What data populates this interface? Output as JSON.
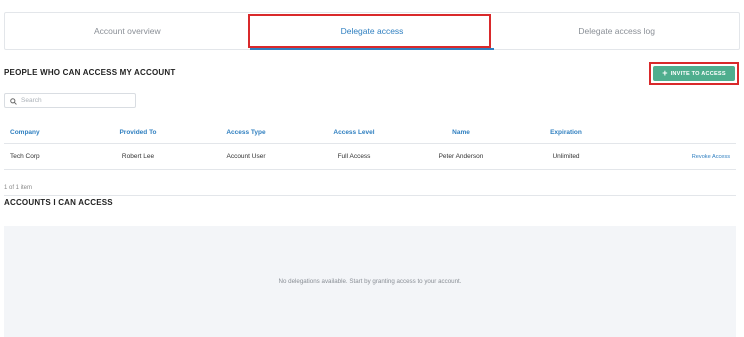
{
  "tabs": [
    {
      "label": "Account overview"
    },
    {
      "label": "Delegate access"
    },
    {
      "label": "Delegate access log"
    }
  ],
  "active_tab": "Delegate access",
  "section1": {
    "title": "PEOPLE WHO CAN ACCESS MY ACCOUNT",
    "invite_button": "INVITE TO ACCESS",
    "search_placeholder": "Search"
  },
  "table": {
    "headers": [
      "Company",
      "Provided To",
      "Access Type",
      "Access Level",
      "Name",
      "Expiration"
    ],
    "rows": [
      {
        "company": "Tech Corp",
        "provided_to": "Robert Lee",
        "access_type": "Account User",
        "access_level": "Full Access",
        "name": "Peter Anderson",
        "expiration": "Unlimited",
        "action": "Revoke Access"
      }
    ]
  },
  "item_count": "1 of 1 item",
  "section2": {
    "title": "ACCOUNTS I CAN ACCESS",
    "empty_message": "No delegations available. Start by granting access to your account."
  },
  "colors": {
    "accent": "#2f7fc0",
    "invite_button": "#4fae8e",
    "highlight": "#d9292b"
  }
}
